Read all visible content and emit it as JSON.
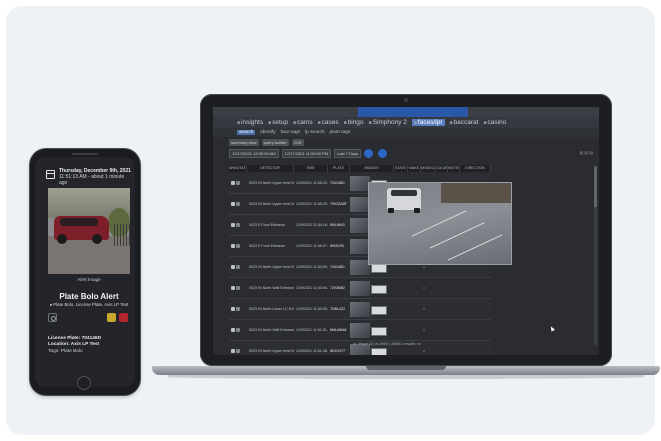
{
  "laptop": {
    "nav": [
      {
        "label": "insights",
        "icon": "chart-icon"
      },
      {
        "label": "setup",
        "icon": "gear-icon"
      },
      {
        "label": "cams",
        "icon": "camera-icon"
      },
      {
        "label": "cases",
        "icon": "folder-icon"
      },
      {
        "label": "bingo",
        "icon": "grid-icon"
      },
      {
        "label": "Simphony 2",
        "icon": "car-icon"
      },
      {
        "label": "faces/lpr",
        "icon": "id-icon",
        "active": true
      },
      {
        "label": "baccarat",
        "icon": "cards-icon"
      },
      {
        "label": "casino",
        "icon": "chip-icon"
      }
    ],
    "subnav": [
      {
        "label": "search",
        "active": true
      },
      {
        "label": "identify"
      },
      {
        "label": "face tags"
      },
      {
        "label": "lp search"
      },
      {
        "label": "plate tags"
      }
    ],
    "toolbar": [
      "summary view",
      "query builder",
      "CLR"
    ],
    "datetime": {
      "from": "12/17/2021 12:00:00 AM",
      "to": "12/17/2021 11:59:59 PM",
      "range": "Last 7 Days"
    },
    "headers": [
      "ANNOTATIONS",
      "DETECTOR",
      "TIME",
      "PLATE",
      "IMAGES",
      "STATE",
      "MAKE",
      "MODEL",
      "COLOR",
      "NOTES",
      "DIRECTION"
    ],
    "rows": [
      {
        "detector": "0023 IN North Upper level Wall",
        "time": "12/9/2021 11:55:22 AM",
        "plate": "704146D",
        "dot": "•"
      },
      {
        "detector": "0023 IN North Upper level Wall",
        "time": "12/9/2021 11:55:25 AM",
        "plate": "7WO2A8F",
        "dot": "•"
      },
      {
        "detector": "0023 E Front Entrance",
        "time": "12/9/2021 11:54:16 AM",
        "plate": "8NL9643",
        "dot": "•"
      },
      {
        "detector": "0023 E Front Entrance",
        "time": "12/9/2021 11:55:07 AM",
        "plate": "8SMV03",
        "dot": "•"
      },
      {
        "detector": "0023 IN North Upper level Wall",
        "time": "12/9/2021 11:54:00 AM",
        "plate": "704146D",
        "dot": "•"
      },
      {
        "detector": "0023 IN North Wall Entrance",
        "time": "12/9/2021 11:53:06 AM",
        "plate": "7ZKB882",
        "dot": "•"
      },
      {
        "detector": "0023 IN North Lower LC Exit",
        "time": "12/9/2021 11:53:06 AM",
        "plate": "7DBL4Z2",
        "dot": "•"
      },
      {
        "detector": "0023 IN North Wall Entrance",
        "time": "12/9/2021 11:51:51 AM",
        "plate": "6MLM6A8",
        "dot": "•"
      },
      {
        "detector": "0023 IN North Upper level Wall",
        "time": "12/9/2021 11:51:38 AM",
        "plate": "8K2G077",
        "dot": "•"
      },
      {
        "detector": "0023 E Front Entrance",
        "time": "12/9/2021 11:51:20 AM",
        "plate": "8NTA013",
        "dot": "•"
      }
    ],
    "pager": "◂ ‹ Page [1] of 2855 | 28551 results › ▸"
  },
  "phone": {
    "date": "Thursday, December 9th, 2021",
    "time": "11:51:13 AM - about 1 minute ago",
    "image_caption": "Alert Image",
    "alert_title": "Plate Bolo Alert",
    "alert_subtitle": "Plate Bolo, License Plate, Axis LP Test",
    "license_plate": "License Plate: 704146D",
    "location": "Location: Axis LP Test",
    "tags": "Tags: Plate Bolo"
  },
  "colors": {
    "accent": "#2d67c5",
    "alert_yellow": "#c9a82b",
    "alert_red": "#b3262d"
  }
}
